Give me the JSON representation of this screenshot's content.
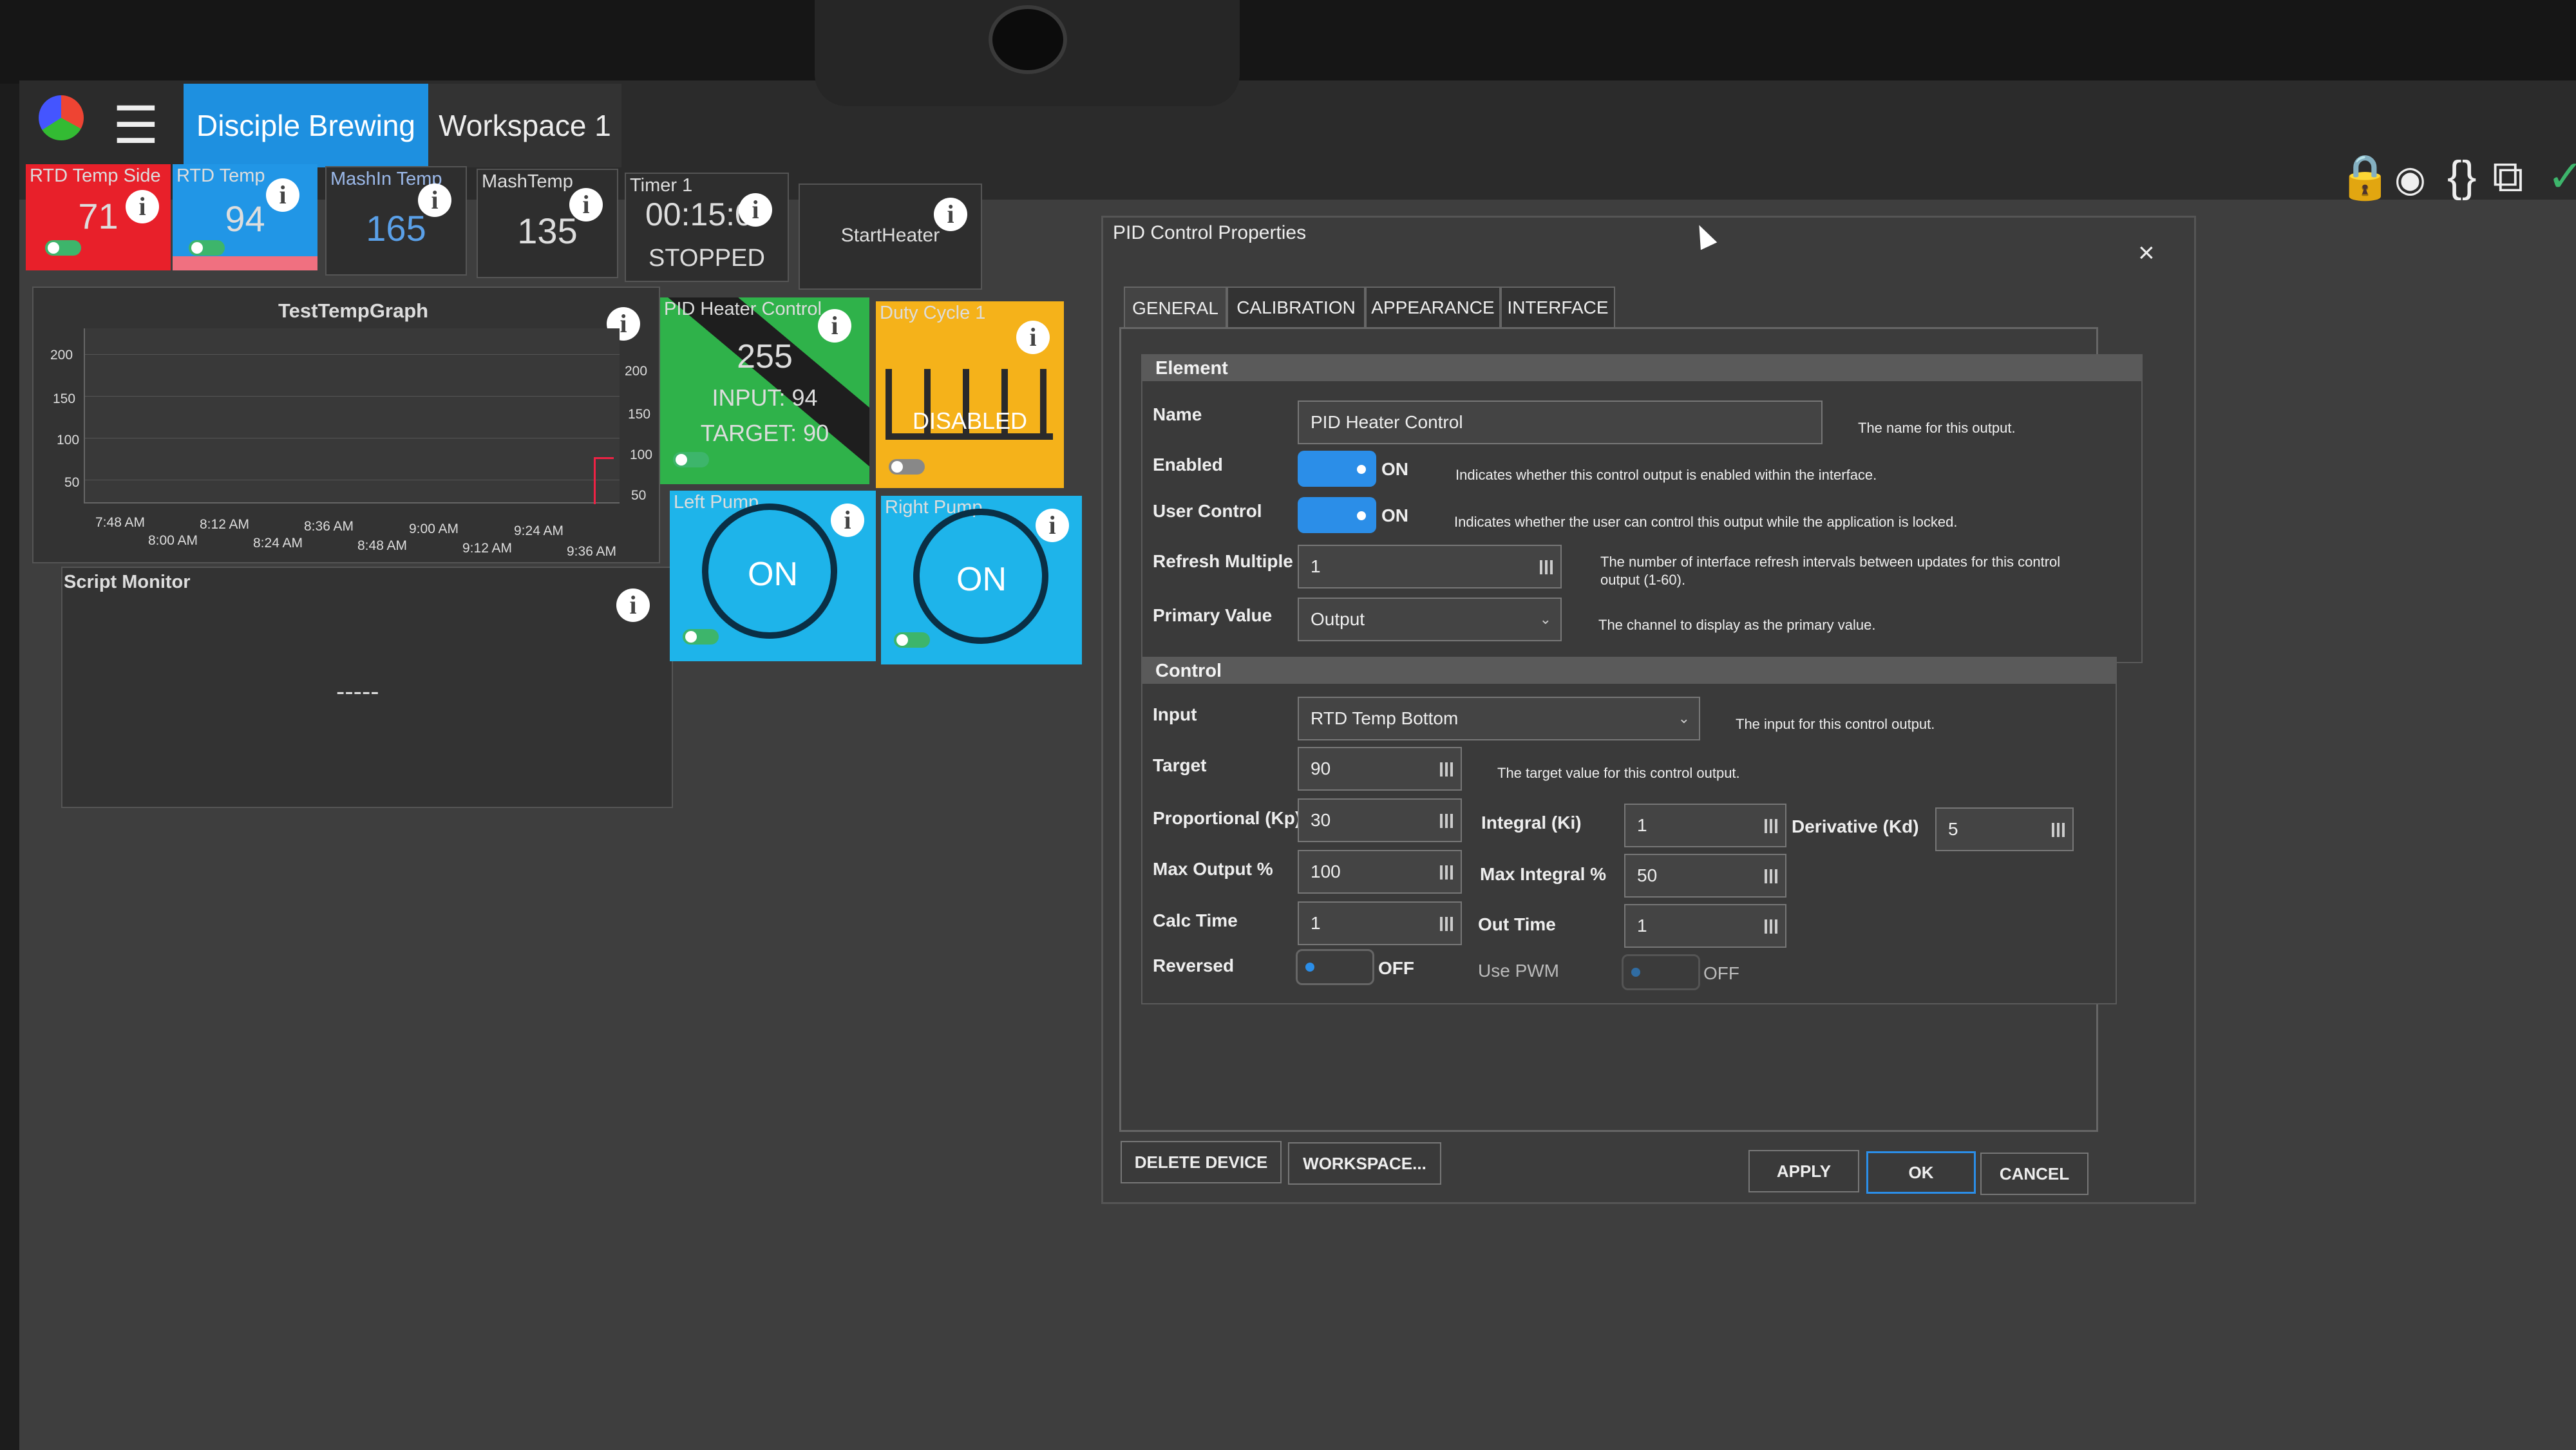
{
  "app": {
    "tabs": [
      {
        "label": "Disciple Brewing",
        "active": true
      },
      {
        "label": "Workspace 1",
        "active": false
      }
    ],
    "toolbar_icons": [
      "lock-icon",
      "eye-icon",
      "braces-icon",
      "chart-icon",
      "check-icon"
    ]
  },
  "tiles": [
    {
      "title": "RTD Temp Side",
      "value": "71",
      "color": "#e8202a"
    },
    {
      "title": "RTD Temp",
      "value": "94",
      "color": "#2196e6"
    },
    {
      "title": "MashIn Temp",
      "value": "165"
    },
    {
      "title": "MashTemp",
      "value": "135"
    },
    {
      "title": "Timer 1",
      "value": "00:15:0",
      "status": "STOPPED"
    },
    {
      "title": "StartHeater"
    }
  ],
  "graph": {
    "title": "TestTempGraph",
    "y_left_ticks": [
      "200",
      "150",
      "100",
      "50"
    ],
    "y_right_ticks": [
      "200",
      "150",
      "100",
      "50"
    ],
    "x_ticks_top": [
      "7:48 AM",
      "8:12 AM",
      "8:36 AM",
      "9:00 AM",
      "9:24 AM"
    ],
    "x_ticks_bottom": [
      "8:00 AM",
      "8:24 AM",
      "8:48 AM",
      "9:12 AM",
      "9:36 AM"
    ]
  },
  "script_monitor": {
    "title": "Script Monitor",
    "value": "-----"
  },
  "pid_tile": {
    "title": "PID Heater Control",
    "value": "255",
    "input": "INPUT: 94",
    "target": "TARGET: 90",
    "color": "#2fb24a"
  },
  "duty_tile": {
    "title": "Duty Cycle 1",
    "status": "DISABLED",
    "color": "#f5b21a"
  },
  "left_pump": {
    "title": "Left Pump",
    "state": "ON",
    "color": "#1eb4ea"
  },
  "right_pump": {
    "title": "Right Pump",
    "state": "ON",
    "color": "#1eb4ea"
  },
  "dialog": {
    "title": "PID Control Properties",
    "tabs": [
      "GENERAL",
      "CALIBRATION",
      "APPEARANCE",
      "INTERFACE"
    ],
    "element": {
      "header": "Element",
      "name_label": "Name",
      "name_value": "PID Heater Control",
      "name_desc": "The name for this output.",
      "enabled_label": "Enabled",
      "enabled_state": "ON",
      "enabled_desc": "Indicates whether this control output is enabled within the interface.",
      "user_control_label": "User Control",
      "user_control_state": "ON",
      "user_control_desc": "Indicates whether the user can control this output while the application is locked.",
      "refresh_label": "Refresh Multiple",
      "refresh_value": "1",
      "refresh_desc_1": "The number of interface refresh intervals between updates for this control",
      "refresh_desc_2": "output (1-60).",
      "primary_label": "Primary Value",
      "primary_value": "Output",
      "primary_desc": "The channel to display as the primary value."
    },
    "control": {
      "header": "Control",
      "input_label": "Input",
      "input_value": "RTD Temp Bottom",
      "input_desc": "The input for this control output.",
      "target_label": "Target",
      "target_value": "90",
      "target_desc": "The target value for this control output.",
      "kp_label": "Proportional (Kp)",
      "kp_value": "30",
      "ki_label": "Integral (Ki)",
      "ki_value": "1",
      "kd_label": "Derivative (Kd)",
      "kd_value": "5",
      "max_output_label": "Max Output %",
      "max_output_value": "100",
      "max_integral_label": "Max Integral %",
      "max_integral_value": "50",
      "calc_time_label": "Calc Time",
      "calc_time_value": "1",
      "out_time_label": "Out Time",
      "out_time_value": "1",
      "reversed_label": "Reversed",
      "reversed_state": "OFF",
      "use_pwm_label": "Use PWM",
      "use_pwm_state": "OFF"
    },
    "buttons": {
      "delete": "DELETE DEVICE",
      "workspace": "WORKSPACE...",
      "apply": "APPLY",
      "ok": "OK",
      "cancel": "CANCEL"
    }
  }
}
